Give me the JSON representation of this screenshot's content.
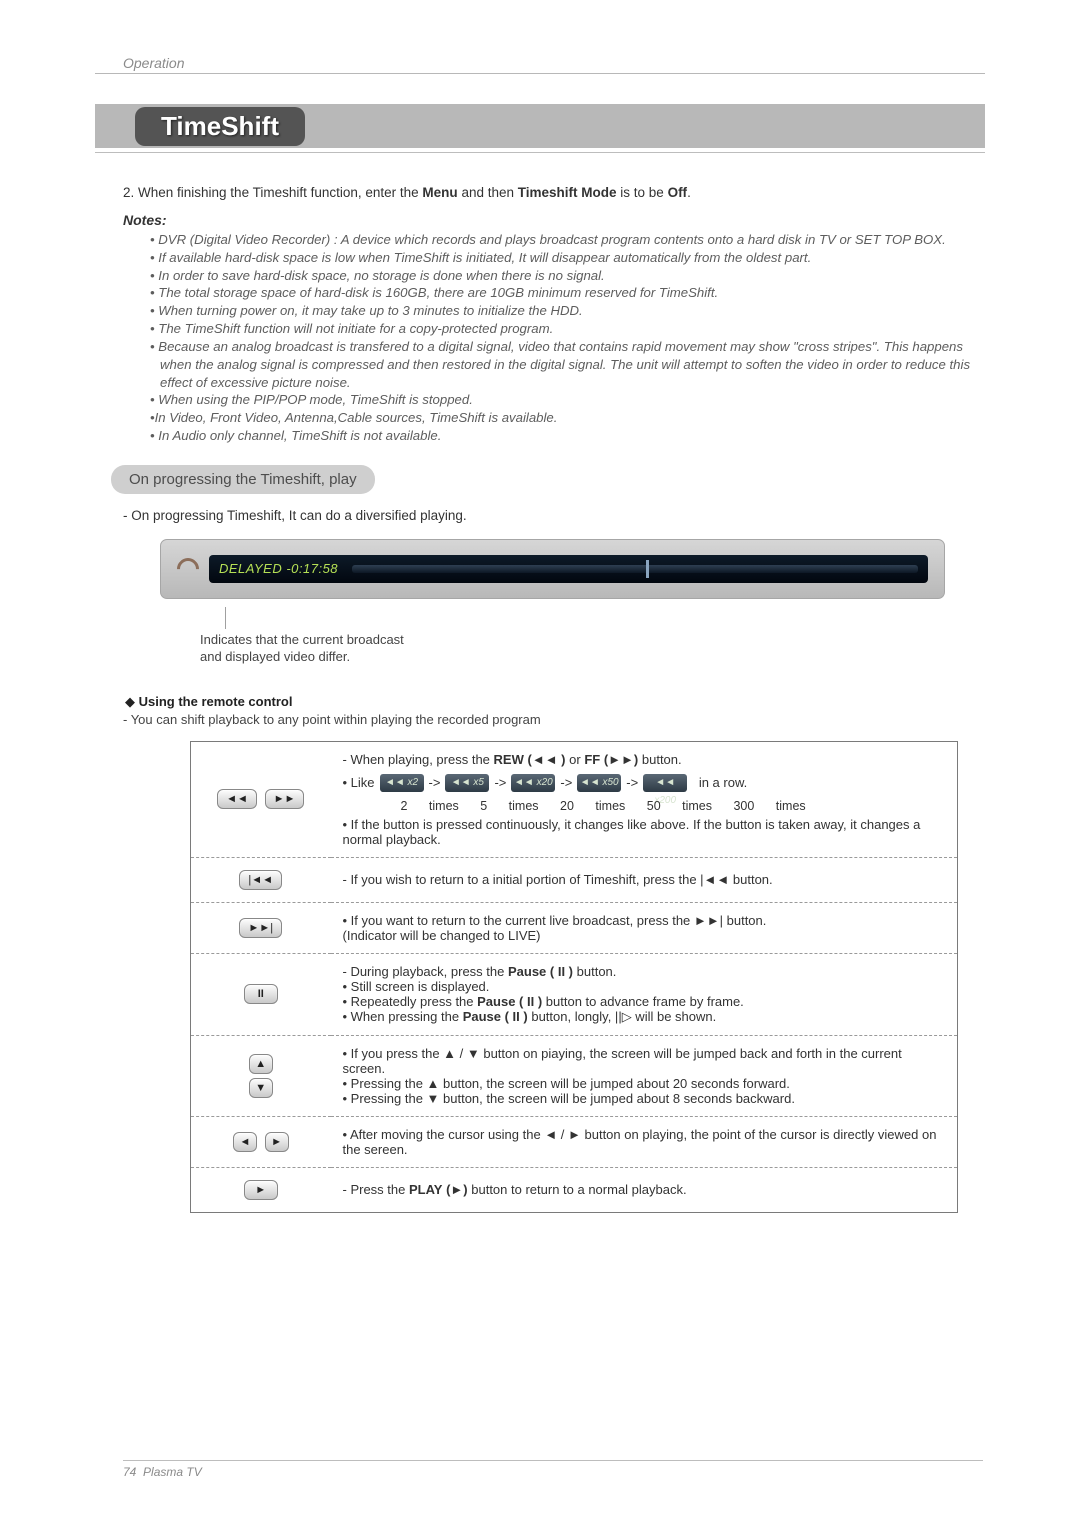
{
  "page": {
    "context": "Operation",
    "title": "TimeShift"
  },
  "step2": {
    "prefix": "2. When finishing the Timeshift function, enter the ",
    "menu": "Menu",
    "mid1": " and then ",
    "mode": "Timeshift Mode",
    "mid2": " is to be ",
    "off": "Off",
    "suffix": "."
  },
  "notes": {
    "heading": "Notes:",
    "items": [
      "• DVR (Digital Video Recorder) : A device which records and plays broadcast program contents onto a hard disk in TV or SET TOP BOX.",
      "• If available hard-disk space is low when TimeShift is initiated, It will disappear automatically from the oldest part.",
      "• In order to save hard-disk space, no storage is done when there is no signal.",
      "• The total storage space of hard-disk is 160GB, there are 10GB minimum reserved for TimeShift.",
      "• When turning power on, it may take up to 3 minutes to initialize the HDD.",
      "• The TimeShift function will not initiate for a copy-protected program.",
      "• Because an analog broadcast is transfered to a digital signal, video that contains rapid movement may show \"cross stripes\". This happens when the analog signal is compressed and then restored in the digital signal. The unit will attempt to soften the video in order to reduce this effect of excessive picture noise.",
      "• When using the PIP/POP mode, TimeShift is stopped.",
      "•In Video, Front Video, Antenna,Cable sources, TimeShift is available.",
      "• In Audio only channel, TimeShift is not available."
    ]
  },
  "progress": {
    "heading": "On progressing the Timeshift, play",
    "desc": "-  On progressing Timeshift, It can do a diversified playing.",
    "delayed_label": "DELAYED  -0:17:58",
    "annotation1": "Indicates that the current broadcast",
    "annotation2": "and displayed video differ."
  },
  "remote": {
    "heading": "Using the remote control",
    "sub": "- You can shift playback to any point within playing the recorded program"
  },
  "rows": {
    "0": {
      "l1a": "- When playing, press the",
      "rew": "REW",
      "l1b": "or",
      "ff": "FF",
      "l1c": "button.",
      "like": "• Like",
      "chips": [
        "◄◄ x2",
        "◄◄ x5",
        "◄◄ x20",
        "◄◄ x50",
        "◄◄ x200"
      ],
      "inrow": "in a  row.",
      "speedLabels": "2 times 5 times 20 times 50 times 300 times",
      "l3": "• If the button is pressed continuously, it changes like above. If the button is taken away, it changes a normal playback."
    },
    "1": {
      "text": "- If you wish to return to a initial portion of Timeshift, press the |◄◄ button."
    },
    "2": {
      "line1": "• If you want to return to the current live broadcast, press the ►►| button.",
      "line2": "  (Indicator will be changed to LIVE)"
    },
    "3": {
      "a": "- During playback, press the",
      "pause": "Pause ( II )",
      "b": "button.",
      "c": "• Still screen is displayed.",
      "d1": "• Repeatedly press the",
      "d2": "button to advance frame by frame.",
      "e1": "• When pressing the",
      "e2": "button, longly, ||▷ will be shown."
    },
    "4": {
      "a": "• If you press the ▲ / ▼ button on piaying, the screen will be jumped back and forth in the current screen.",
      "b": "• Pressing the ▲ button, the screen will be jumped about 20 seconds forward.",
      "c": "• Pressing the ▼ button, the screen will be jumped about 8 seconds backward."
    },
    "5": {
      "text": "• After moving the cursor using the ◄ / ► button on playing, the point of the cursor is directly viewed on the sereen."
    },
    "6": {
      "a": "- Press the",
      "play": "PLAY",
      "b": "button to return to a normal playback."
    }
  },
  "footer": {
    "page": "74",
    "label": "Plasma TV"
  }
}
